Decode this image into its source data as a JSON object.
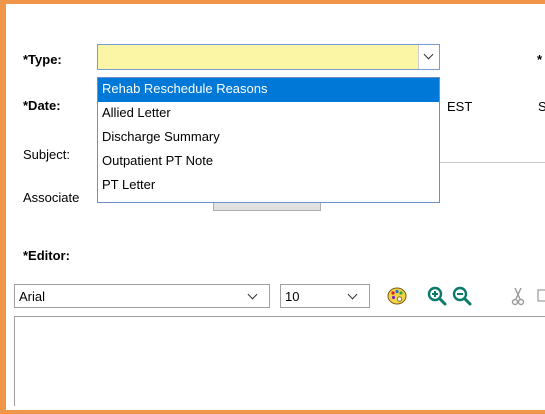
{
  "form": {
    "type_label": "*Type:",
    "date_label": "*Date:",
    "subject_label": "Subject:",
    "associate_label": "Associate",
    "time_zone": "EST",
    "type_value": "",
    "editor_label": "*Editor:"
  },
  "type_dropdown": {
    "options": [
      "Rehab Reschedule Reasons",
      "Allied Letter",
      "Discharge Summary",
      "Outpatient PT Note",
      "PT Letter"
    ],
    "selected": "Rehab Reschedule Reasons"
  },
  "editor_toolbar": {
    "font": "Arial",
    "size": "10"
  },
  "icons": {
    "palette": "palette-icon",
    "zoom_in": "zoom-in-icon",
    "zoom_out": "zoom-out-icon",
    "cut": "cut-icon"
  },
  "colors": {
    "frame_border": "#f0964a",
    "type_field_bg": "#fbf5a6",
    "selected_item_bg": "#0078d7"
  }
}
